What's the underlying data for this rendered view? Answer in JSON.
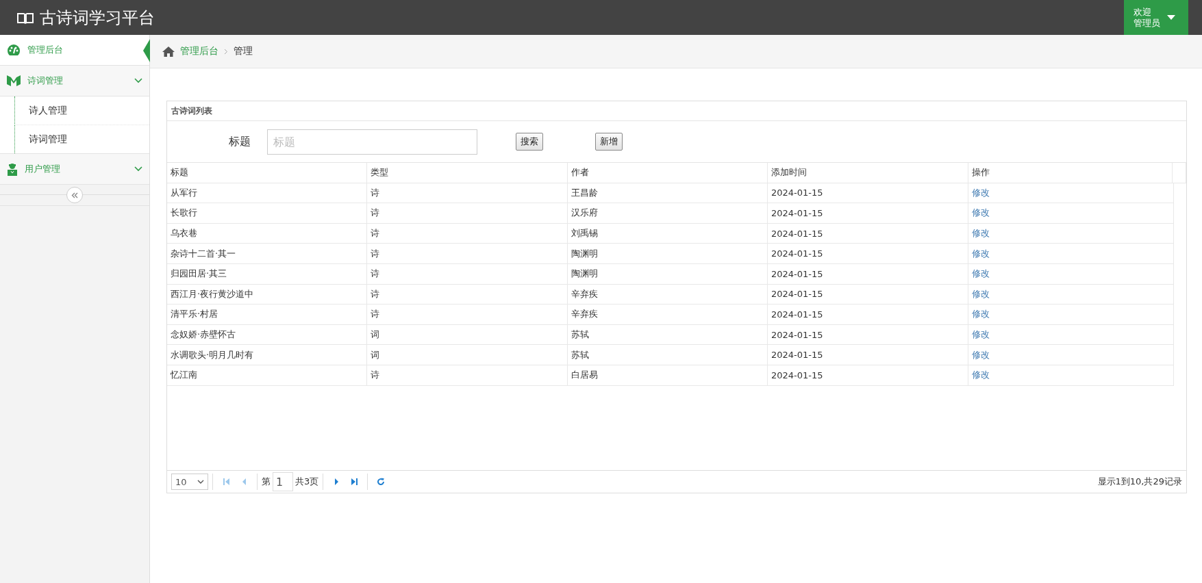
{
  "header": {
    "title": "古诗词学习平台",
    "user_menu": {
      "greeting": "欢迎",
      "user": "管理员"
    }
  },
  "sidebar": {
    "items": [
      {
        "kind": "link",
        "label": "管理后台",
        "selected": true
      },
      {
        "kind": "group",
        "label": "诗词管理",
        "expanded": true,
        "children": [
          {
            "label": "诗人管理",
            "selected": false
          },
          {
            "label": "诗词管理",
            "selected": false
          }
        ]
      },
      {
        "kind": "group",
        "label": "用户管理"
      }
    ]
  },
  "breadcrumb": {
    "home": "管理后台",
    "current": "管理"
  },
  "panel": {
    "title": "古诗词列表",
    "search": {
      "label": "标题",
      "placeholder": "标题"
    },
    "buttons": [
      "搜索",
      "新增"
    ]
  },
  "table": {
    "columns": [
      "标题",
      "类型",
      "作者",
      "添加时间",
      "操作"
    ],
    "rows": [
      {
        "title": "从军行",
        "type": "诗",
        "author": "王昌龄",
        "date": "2024-01-15",
        "action": "修改"
      },
      {
        "title": "长歌行",
        "type": "诗",
        "author": "汉乐府",
        "date": "2024-01-15",
        "action": "修改"
      },
      {
        "title": "乌衣巷",
        "type": "诗",
        "author": "刘禹锡",
        "date": "2024-01-15",
        "action": "修改"
      },
      {
        "title": "杂诗十二首·其一",
        "type": "诗",
        "author": "陶渊明",
        "date": "2024-01-15",
        "action": "修改"
      },
      {
        "title": "归园田居·其三",
        "type": "诗",
        "author": "陶渊明",
        "date": "2024-01-15",
        "action": "修改"
      },
      {
        "title": "西江月·夜行黄沙道中",
        "type": "诗",
        "author": "辛弃疾",
        "date": "2024-01-15",
        "action": "修改"
      },
      {
        "title": "清平乐·村居",
        "type": "诗",
        "author": "辛弃疾",
        "date": "2024-01-15",
        "action": "修改"
      },
      {
        "title": "念奴娇·赤壁怀古",
        "type": "词",
        "author": "苏轼",
        "date": "2024-01-15",
        "action": "修改"
      },
      {
        "title": "水调歌头·明月几时有",
        "type": "词",
        "author": "苏轼",
        "date": "2024-01-15",
        "action": "修改"
      },
      {
        "title": "忆江南",
        "type": "诗",
        "author": "白居易",
        "date": "2024-01-15",
        "action": "修改"
      }
    ]
  },
  "pagination": {
    "page_size": "10",
    "page_prefix": "第",
    "page": "1",
    "page_total": "共3页",
    "nav": [
      {
        "kind": "first",
        "disabled": true
      },
      {
        "kind": "prev",
        "disabled": true
      },
      {
        "kind": "next",
        "disabled": false
      },
      {
        "kind": "last",
        "disabled": false
      }
    ],
    "info": "显示1到10,共29记录"
  }
}
